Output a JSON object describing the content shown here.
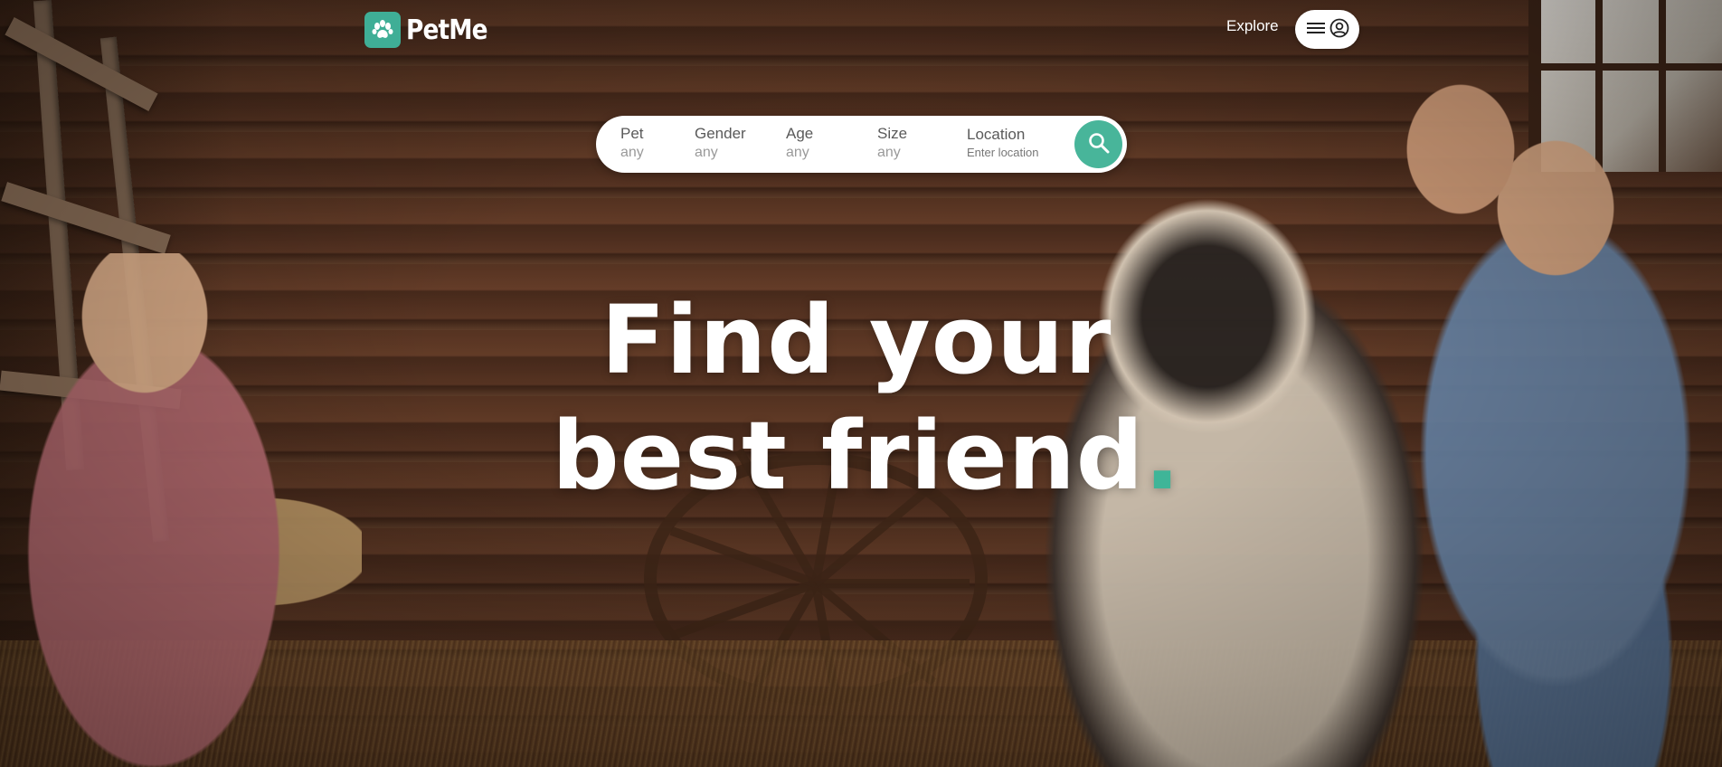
{
  "brand": {
    "name": "PetMe",
    "accent": "#3fae96"
  },
  "nav": {
    "explore_label": "Explore",
    "menu_icon": "hamburger-icon",
    "account_icon": "user-circle-icon"
  },
  "search": {
    "fields": [
      {
        "label": "Pet",
        "value": "any"
      },
      {
        "label": "Gender",
        "value": "any"
      },
      {
        "label": "Age",
        "value": "any"
      },
      {
        "label": "Size",
        "value": "any"
      },
      {
        "label": "Location",
        "placeholder": "Enter location"
      }
    ],
    "button_icon": "search-icon",
    "button_color": "#48b59a"
  },
  "hero": {
    "line1": "Find your",
    "line2": "best friend",
    "line2_dot": ".",
    "dot_color": "#3fb598"
  }
}
